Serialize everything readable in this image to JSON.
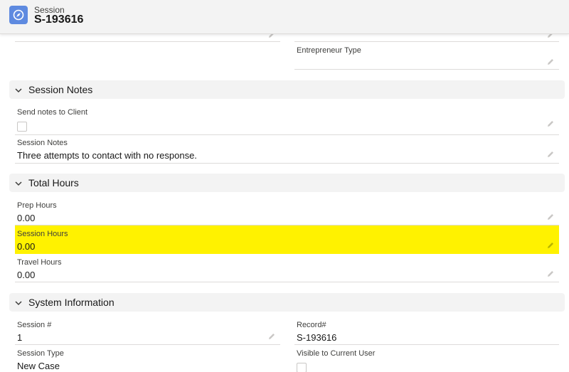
{
  "header": {
    "object_type": "Session",
    "record_name": "S-193616",
    "icon": "compass-icon"
  },
  "top_fields": {
    "entrepreneur_type_label": "Entrepreneur Type",
    "entrepreneur_type_value": ""
  },
  "sections": {
    "session_notes": {
      "title": "Session Notes",
      "send_notes_label": "Send notes to Client",
      "send_notes_checked": false,
      "notes_label": "Session Notes",
      "notes_value": "Three attempts to contact with no response."
    },
    "total_hours": {
      "title": "Total Hours",
      "prep_label": "Prep Hours",
      "prep_value": "0.00",
      "session_label": "Session Hours",
      "session_value": "0.00",
      "travel_label": "Travel Hours",
      "travel_value": "0.00"
    },
    "system_information": {
      "title": "System Information",
      "session_num_label": "Session #",
      "session_num_value": "1",
      "record_num_label": "Record#",
      "record_num_value": "S-193616",
      "session_type_label": "Session Type",
      "session_type_value": "New Case",
      "visible_label": "Visible to Current User",
      "visible_checked": false
    }
  },
  "colors": {
    "highlight": "#fff200",
    "brand_icon": "#5e8ae0"
  }
}
